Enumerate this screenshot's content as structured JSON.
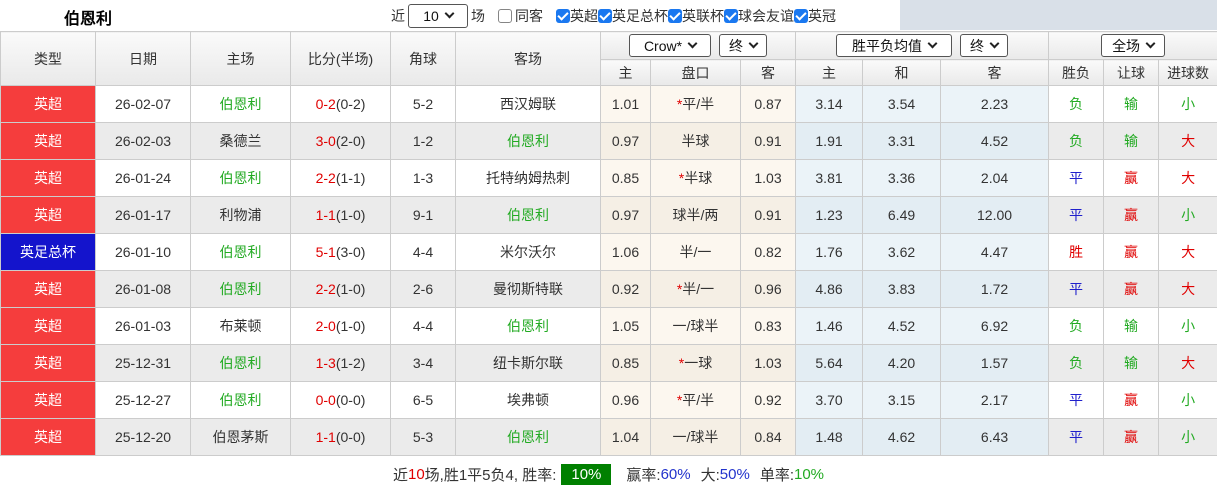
{
  "title": "伯恩利",
  "topbar": {
    "recent_label": "近",
    "matches_select": "10",
    "matches_label": "场",
    "same_away": {
      "label": "同客",
      "state": "off"
    },
    "leagues": [
      {
        "label": "英超",
        "state": "on"
      },
      {
        "label": "英足总杯",
        "state": "on"
      },
      {
        "label": "英联杯",
        "state": "on"
      },
      {
        "label": "球会友谊",
        "state": "on"
      },
      {
        "label": "英冠",
        "state": "on"
      }
    ]
  },
  "header": {
    "selects": {
      "bookmaker": "Crow*",
      "ah_time": "终",
      "eu_mean": "胜平负均值",
      "eu_time": "终",
      "scope": "全场"
    },
    "cols": {
      "type": "类型",
      "date": "日期",
      "home": "主场",
      "score": "比分(半场)",
      "corner": "角球",
      "away": "客场",
      "ah_home": "主",
      "ah_line": "盘口",
      "ah_away": "客",
      "eu_home": "主",
      "eu_draw": "和",
      "eu_away": "客",
      "res_outcome": "胜负",
      "res_handicap": "让球",
      "res_goals": "进球数"
    }
  },
  "colors": {
    "league_premier_bg": "#f53d3d",
    "league_facup_bg": "#1414cc",
    "win_red": "#e00000",
    "draw_blue": "#2020cc",
    "loss_green": "#22aa22",
    "rate_badge_bg": "#008000",
    "checkbox_blue": "#1a78f0"
  },
  "rows": [
    {
      "type": "英超",
      "type_cls": "t-red",
      "date": "26-02-07",
      "home": "伯恩利",
      "home_cls": "green",
      "ft": "0-2",
      "ht": "(0-2)",
      "corner": "5-2",
      "away": "西汉姆联",
      "away_cls": "",
      "ah_star": "*",
      "ah_home": "1.01",
      "ah_line": "平/半",
      "ah_away": "0.87",
      "eu_home": "3.14",
      "eu_draw": "3.54",
      "eu_away": "2.23",
      "outcome": "负",
      "outcome_cls": "green",
      "handicap": "输",
      "handicap_cls": "green",
      "goals": "小",
      "goals_cls": "green"
    },
    {
      "type": "英超",
      "type_cls": "t-red",
      "date": "26-02-03",
      "home": "桑德兰",
      "home_cls": "",
      "ft": "3-0",
      "ht": "(2-0)",
      "corner": "1-2",
      "away": "伯恩利",
      "away_cls": "green",
      "ah_star": "",
      "ah_home": "0.97",
      "ah_line": "半球",
      "ah_away": "0.91",
      "eu_home": "1.91",
      "eu_draw": "3.31",
      "eu_away": "4.52",
      "outcome": "负",
      "outcome_cls": "green",
      "handicap": "输",
      "handicap_cls": "green",
      "goals": "大",
      "goals_cls": "red"
    },
    {
      "type": "英超",
      "type_cls": "t-red",
      "date": "26-01-24",
      "home": "伯恩利",
      "home_cls": "green",
      "ft": "2-2",
      "ht": "(1-1)",
      "corner": "1-3",
      "away": "托特纳姆热刺",
      "away_cls": "",
      "ah_star": "*",
      "ah_home": "0.85",
      "ah_line": "半球",
      "ah_away": "1.03",
      "eu_home": "3.81",
      "eu_draw": "3.36",
      "eu_away": "2.04",
      "outcome": "平",
      "outcome_cls": "blue",
      "handicap": "赢",
      "handicap_cls": "red",
      "goals": "大",
      "goals_cls": "red"
    },
    {
      "type": "英超",
      "type_cls": "t-red",
      "date": "26-01-17",
      "home": "利物浦",
      "home_cls": "",
      "ft": "1-1",
      "ht": "(1-0)",
      "corner": "9-1",
      "away": "伯恩利",
      "away_cls": "green",
      "ah_star": "",
      "ah_home": "0.97",
      "ah_line": "球半/两",
      "ah_away": "0.91",
      "eu_home": "1.23",
      "eu_draw": "6.49",
      "eu_away": "12.00",
      "outcome": "平",
      "outcome_cls": "blue",
      "handicap": "赢",
      "handicap_cls": "red",
      "goals": "小",
      "goals_cls": "green"
    },
    {
      "type": "英足总杯",
      "type_cls": "t-blue",
      "date": "26-01-10",
      "home": "伯恩利",
      "home_cls": "green",
      "ft": "5-1",
      "ht": "(3-0)",
      "corner": "4-4",
      "away": "米尔沃尔",
      "away_cls": "",
      "ah_star": "",
      "ah_home": "1.06",
      "ah_line": "半/一",
      "ah_away": "0.82",
      "eu_home": "1.76",
      "eu_draw": "3.62",
      "eu_away": "4.47",
      "outcome": "胜",
      "outcome_cls": "red",
      "handicap": "赢",
      "handicap_cls": "red",
      "goals": "大",
      "goals_cls": "red"
    },
    {
      "type": "英超",
      "type_cls": "t-red",
      "date": "26-01-08",
      "home": "伯恩利",
      "home_cls": "green",
      "ft": "2-2",
      "ht": "(1-0)",
      "corner": "2-6",
      "away": "曼彻斯特联",
      "away_cls": "",
      "ah_star": "*",
      "ah_home": "0.92",
      "ah_line": "半/一",
      "ah_away": "0.96",
      "eu_home": "4.86",
      "eu_draw": "3.83",
      "eu_away": "1.72",
      "outcome": "平",
      "outcome_cls": "blue",
      "handicap": "赢",
      "handicap_cls": "red",
      "goals": "大",
      "goals_cls": "red"
    },
    {
      "type": "英超",
      "type_cls": "t-red",
      "date": "26-01-03",
      "home": "布莱顿",
      "home_cls": "",
      "ft": "2-0",
      "ht": "(1-0)",
      "corner": "4-4",
      "away": "伯恩利",
      "away_cls": "green",
      "ah_star": "",
      "ah_home": "1.05",
      "ah_line": "一/球半",
      "ah_away": "0.83",
      "eu_home": "1.46",
      "eu_draw": "4.52",
      "eu_away": "6.92",
      "outcome": "负",
      "outcome_cls": "green",
      "handicap": "输",
      "handicap_cls": "green",
      "goals": "小",
      "goals_cls": "green"
    },
    {
      "type": "英超",
      "type_cls": "t-red",
      "date": "25-12-31",
      "home": "伯恩利",
      "home_cls": "green",
      "ft": "1-3",
      "ht": "(1-2)",
      "corner": "3-4",
      "away": "纽卡斯尔联",
      "away_cls": "",
      "ah_star": "*",
      "ah_home": "0.85",
      "ah_line": "一球",
      "ah_away": "1.03",
      "eu_home": "5.64",
      "eu_draw": "4.20",
      "eu_away": "1.57",
      "outcome": "负",
      "outcome_cls": "green",
      "handicap": "输",
      "handicap_cls": "green",
      "goals": "大",
      "goals_cls": "red"
    },
    {
      "type": "英超",
      "type_cls": "t-red",
      "date": "25-12-27",
      "home": "伯恩利",
      "home_cls": "green",
      "ft": "0-0",
      "ht": "(0-0)",
      "corner": "6-5",
      "away": "埃弗顿",
      "away_cls": "",
      "ah_star": "*",
      "ah_home": "0.96",
      "ah_line": "平/半",
      "ah_away": "0.92",
      "eu_home": "3.70",
      "eu_draw": "3.15",
      "eu_away": "2.17",
      "outcome": "平",
      "outcome_cls": "blue",
      "handicap": "赢",
      "handicap_cls": "red",
      "goals": "小",
      "goals_cls": "green"
    },
    {
      "type": "英超",
      "type_cls": "t-red",
      "date": "25-12-20",
      "home": "伯恩茅斯",
      "home_cls": "",
      "ft": "1-1",
      "ht": "(0-0)",
      "corner": "5-3",
      "away": "伯恩利",
      "away_cls": "green",
      "ah_star": "",
      "ah_home": "1.04",
      "ah_line": "一/球半",
      "ah_away": "0.84",
      "eu_home": "1.48",
      "eu_draw": "4.62",
      "eu_away": "6.43",
      "outcome": "平",
      "outcome_cls": "blue",
      "handicap": "赢",
      "handicap_cls": "red",
      "goals": "小",
      "goals_cls": "green"
    }
  ],
  "footer": {
    "prefix": "近",
    "count": "10",
    "stats": "场,胜1平5负4, 胜率:",
    "win_rate_badge": "10%",
    "odds_win_label": "赢率:",
    "odds_win_value": "60%",
    "big_label": "大:",
    "big_value": "50%",
    "single_label": "单率:",
    "single_value": "10%"
  }
}
